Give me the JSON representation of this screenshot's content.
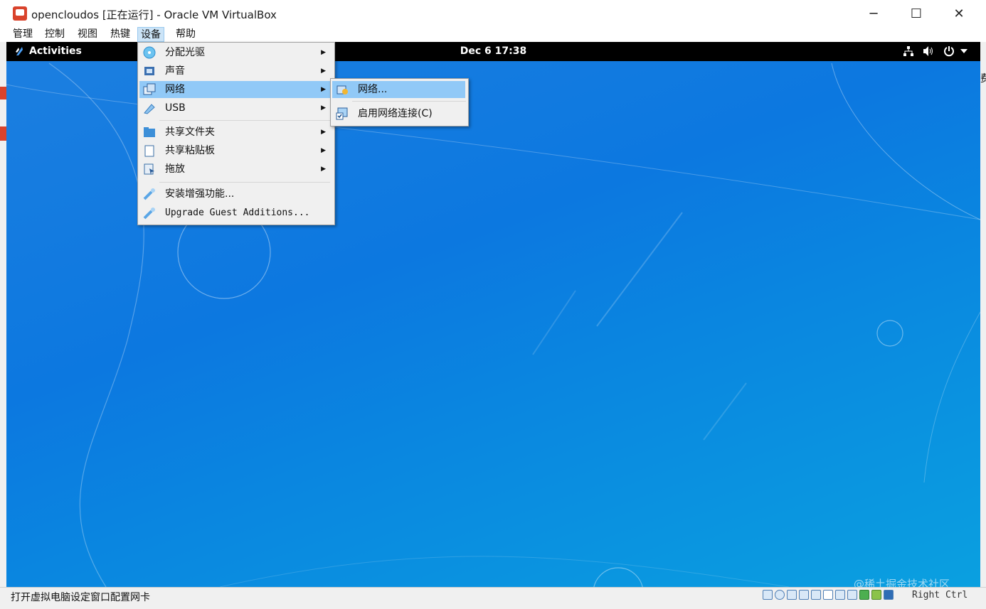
{
  "window": {
    "title": "opencloudos [正在运行] - Oracle VM VirtualBox",
    "controls": {
      "minimize": "─",
      "maximize": "☐",
      "close": "✕"
    }
  },
  "menubar": {
    "items": [
      "管理",
      "控制",
      "视图",
      "热键",
      "设备",
      "帮助"
    ],
    "active": "设备"
  },
  "guest": {
    "activities": "Activities",
    "clock": "Dec 6  17:38",
    "tray_icons": [
      "network-icon",
      "volume-icon",
      "power-icon",
      "chevron-down-icon"
    ]
  },
  "devices_menu": {
    "items": [
      {
        "label": "分配光驱",
        "icon": "optical-disk-icon",
        "submenu": true
      },
      {
        "label": "声音",
        "icon": "audio-icon",
        "submenu": true
      },
      {
        "label": "网络",
        "icon": "network-adapter-icon",
        "submenu": true,
        "highlighted": true
      },
      {
        "label": "USB",
        "icon": "usb-icon",
        "submenu": true
      },
      {
        "label": "共享文件夹",
        "icon": "shared-folder-icon",
        "submenu": true
      },
      {
        "label": "共享粘贴板",
        "icon": "clipboard-icon",
        "submenu": true
      },
      {
        "label": "拖放",
        "icon": "drag-drop-icon",
        "submenu": true
      },
      {
        "label": "安装增强功能...",
        "icon": "guest-additions-icon",
        "submenu": false
      },
      {
        "label": "Upgrade Guest Additions...",
        "icon": "guest-additions-icon",
        "submenu": false
      }
    ]
  },
  "network_submenu": {
    "items": [
      {
        "label": "网络...",
        "icon": "network-settings-icon",
        "highlighted": true
      },
      {
        "label": "启用网络连接(C)",
        "icon": "network-connect-icon",
        "highlighted": false
      }
    ]
  },
  "statusbar": {
    "text": "打开虚拟电脑设定窗口配置网卡",
    "host_key": "Right Ctrl"
  },
  "watermark": "@稀土掘金技术社区",
  "right_edge_text": "费"
}
